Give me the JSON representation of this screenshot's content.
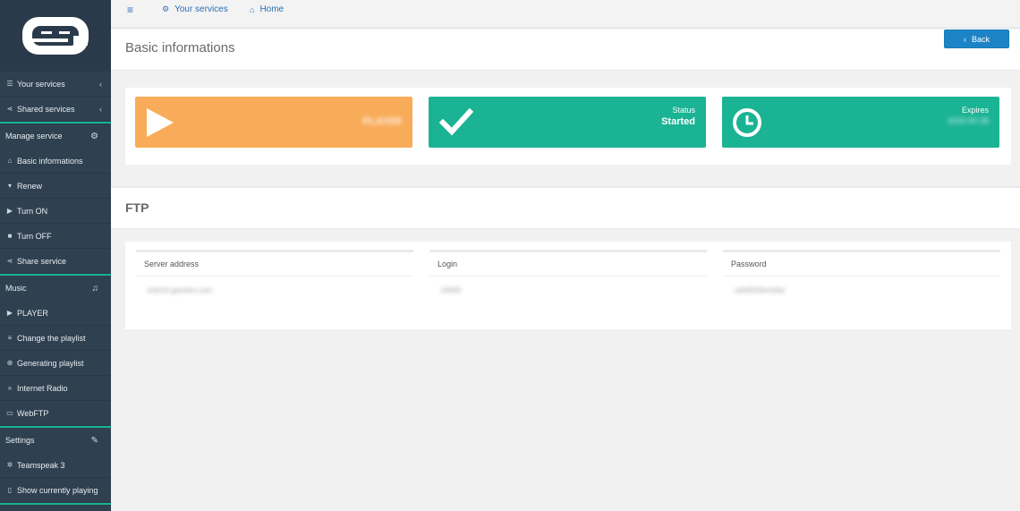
{
  "topbar": {
    "your_services": "Your services",
    "home": "Home"
  },
  "sidebar": {
    "items": [
      {
        "label": "Your services",
        "icon": "list-icon"
      },
      {
        "label": "Shared services",
        "icon": "share-icon"
      }
    ],
    "sections": {
      "manage": "Manage service",
      "music": "Music",
      "settings": "Settings"
    },
    "manage_items": [
      {
        "label": "Basic informations",
        "icon": "home-icon"
      },
      {
        "label": "Renew",
        "icon": "cart-icon"
      },
      {
        "label": "Turn ON",
        "icon": "play-icon"
      },
      {
        "label": "Turn OFF",
        "icon": "stop-icon"
      },
      {
        "label": "Share service",
        "icon": "share-icon"
      }
    ],
    "music_items": [
      {
        "label": "PLAYER",
        "icon": "play-icon"
      },
      {
        "label": "Change the playlist",
        "icon": "list-icon"
      },
      {
        "label": "Generating playlist",
        "icon": "plus-circle-icon"
      },
      {
        "label": "Internet Radio",
        "icon": "rss-icon"
      },
      {
        "label": "WebFTP",
        "icon": "folder-icon"
      }
    ],
    "settings_items": [
      {
        "label": "Teamspeak 3",
        "icon": "gear-icon"
      },
      {
        "label": "Show currently playing",
        "icon": "file-icon"
      }
    ]
  },
  "header": {
    "title": "Basic informations",
    "back_label": "Back"
  },
  "cards": {
    "player": {
      "label": "PLAYER"
    },
    "status": {
      "label": "Status",
      "value": "Started"
    },
    "expires": {
      "label": "Expires",
      "value": "2020-00-28"
    }
  },
  "ftp": {
    "title": "FTP",
    "columns": [
      {
        "header": "Server address",
        "value": "ts3n02.gamehs.com"
      },
      {
        "header": "Login",
        "value": "20000"
      },
      {
        "header": "Password",
        "value": "u0a5f2d3e2a5d"
      }
    ]
  },
  "colors": {
    "sidebar": "#2f4050",
    "accent_green": "#1ab394",
    "accent_orange": "#f8ac59",
    "primary_blue": "#1c84c6"
  }
}
